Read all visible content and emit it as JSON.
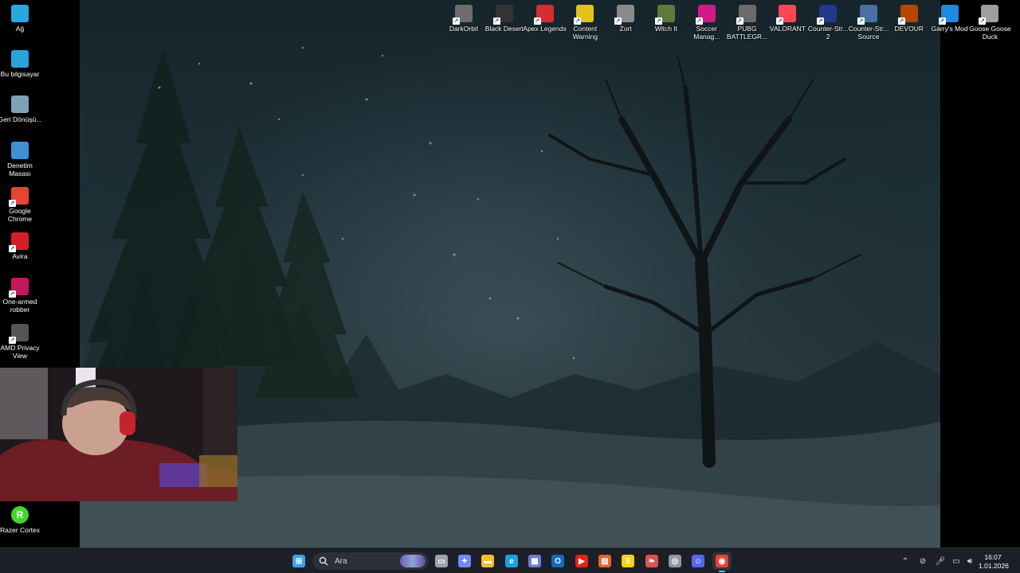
{
  "desktop": {
    "left_icons": [
      {
        "label": "Ağ",
        "icon": "network-icon",
        "color": "#2aa6e0"
      },
      {
        "label": "Bu bilgisayar",
        "icon": "computer-icon",
        "color": "#27a4dd"
      },
      {
        "label": "Geri Dönüşü...",
        "icon": "recycle-bin-icon",
        "color": "#7fa1b5"
      },
      {
        "label": "Denetim Masası",
        "icon": "control-panel-icon",
        "color": "#3d8fd6"
      },
      {
        "label": "Google Chrome",
        "icon": "chrome-icon",
        "color": "#e84335"
      },
      {
        "label": "Avira",
        "icon": "avira-icon",
        "color": "#d51f26"
      },
      {
        "label": "One-armed robber",
        "icon": "one-armed-robber-icon",
        "color": "#c2185b"
      },
      {
        "label": "AMD Privacy View",
        "icon": "amd-privacy-view-icon",
        "color": "#555555"
      }
    ],
    "bottom_left_icon": {
      "label": "Razer Cortex",
      "icon": "razer-cortex-icon",
      "color": "#44d62c"
    },
    "top_icons": [
      {
        "label": "DarkOrbit",
        "icon": "darkorbit-icon",
        "color": "#6d6d6d"
      },
      {
        "label": "Black Desert",
        "icon": "black-desert-icon",
        "color": "#333333"
      },
      {
        "label": "Apex Legends",
        "icon": "apex-legends-icon",
        "color": "#d32f2f"
      },
      {
        "label": "Content Warning",
        "icon": "content-warning-icon",
        "color": "#e3c21a"
      },
      {
        "label": "Zort",
        "icon": "zort-icon",
        "color": "#8a8a8a"
      },
      {
        "label": "Witch It",
        "icon": "witch-it-icon",
        "color": "#5d7a3a"
      },
      {
        "label": "Soccer Manag...",
        "icon": "soccer-manager-icon",
        "color": "#d01a8a"
      },
      {
        "label": "PUBG BATTLEGR...",
        "icon": "pubg-icon",
        "color": "#6b6b6b"
      },
      {
        "label": "VALORANT",
        "icon": "valorant-icon",
        "color": "#ff4655"
      },
      {
        "label": "Counter-Str... 2",
        "icon": "counter-strike-2-icon",
        "color": "#1f3a8a"
      },
      {
        "label": "Counter-Str... Source",
        "icon": "counter-strike-source-icon",
        "color": "#4a6fa5"
      },
      {
        "label": "DEVOUR",
        "icon": "devour-icon",
        "color": "#b34700"
      },
      {
        "label": "Garry's Mod",
        "icon": "garrys-mod-icon",
        "color": "#1e88e5"
      },
      {
        "label": "Goose Goose Duck",
        "icon": "goose-goose-duck-icon",
        "color": "#9e9e9e"
      }
    ]
  },
  "taskbar": {
    "search_placeholder": "Ara",
    "pinned": [
      {
        "name": "start-button",
        "icon": "windows-start-icon",
        "color": "#3aa0f0",
        "glyph": "⊞"
      },
      {
        "name": "task-view-button",
        "icon": "task-view-icon",
        "color": "#9aa3b0",
        "glyph": "▭"
      },
      {
        "name": "copilot-button",
        "icon": "copilot-icon",
        "color": "#6a8cff",
        "glyph": "✦"
      },
      {
        "name": "file-explorer-button",
        "icon": "folder-icon",
        "color": "#f2c12e",
        "glyph": "▬"
      },
      {
        "name": "edge-button",
        "icon": "edge-icon",
        "color": "#1ba1e2",
        "glyph": "e"
      },
      {
        "name": "store-button",
        "icon": "store-icon",
        "color": "#6f7bd3",
        "glyph": "▦"
      },
      {
        "name": "outlook-button",
        "icon": "outlook-icon",
        "color": "#0f6cbd",
        "glyph": "O"
      },
      {
        "name": "youtube-button",
        "icon": "youtube-icon",
        "color": "#e62117",
        "glyph": "▶"
      },
      {
        "name": "app-orange-button",
        "icon": "orange-app-icon",
        "color": "#e8622b",
        "glyph": "▤"
      },
      {
        "name": "app-s-button",
        "icon": "s-app-icon",
        "color": "#f5d20d",
        "glyph": "S"
      },
      {
        "name": "app-feather-button",
        "icon": "feather-app-icon",
        "color": "#d9534f",
        "glyph": "❧"
      },
      {
        "name": "steam-button",
        "icon": "steam-icon",
        "color": "#8f98a0",
        "glyph": "◎"
      },
      {
        "name": "discord-button",
        "icon": "discord-icon",
        "color": "#5865f2",
        "glyph": "☺"
      },
      {
        "name": "chrome-taskbar-button",
        "icon": "chrome-icon",
        "color": "#e84335",
        "glyph": "◉"
      }
    ],
    "tray": [
      {
        "name": "show-hidden-icons",
        "icon": "chevron-up-icon",
        "glyph": "⌃"
      },
      {
        "name": "network-tray",
        "icon": "network-off-icon",
        "glyph": "⊘"
      },
      {
        "name": "microphone-tray",
        "icon": "microphone-icon",
        "glyph": "🎤︎"
      },
      {
        "name": "display-tray",
        "icon": "display-icon",
        "glyph": "▭"
      },
      {
        "name": "volume-tray",
        "icon": "speaker-icon",
        "glyph": "🔊︎"
      }
    ],
    "clock_time": "16:07",
    "clock_date": "1.01.2026"
  }
}
